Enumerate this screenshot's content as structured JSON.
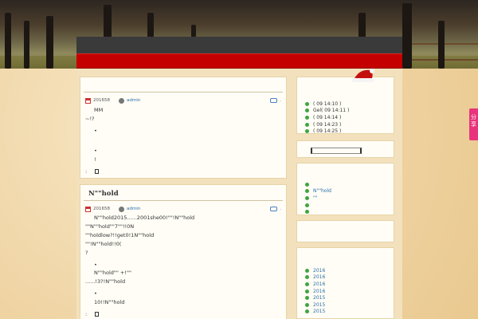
{
  "posts": [
    {
      "title": "",
      "date": "201658",
      "author": "admin",
      "comment_dot": ".",
      "lines": [
        "MM",
        "~!?",
        "",
        "",
        "!"
      ],
      "foot": ":"
    },
    {
      "title": "N\"\"hold",
      "date": "201658",
      "author": "admin",
      "comment_dot": ".",
      "lines": [
        "N\"\"hold2015......2001she00!\"\"!N\"\"hold",
        "\"\"N\"\"hold\"\"7\"\"!!0N",
        "\"\"holdlow?!!get0!1N\"\"hold",
        "\"\"!N\"\"hold!!0(",
        "?",
        "",
        "N\"\"hold\"\" +!\"\"",
        "......!3?!N\"\"hold",
        "",
        "10!!N\"\"hold"
      ],
      "foot": ":"
    }
  ],
  "sidebar": {
    "recent": [
      "( 09 14:10 )",
      "Gel( 09 14:11 )",
      "( 09 14:14 )",
      "( 09 14:23 )",
      "( 09 14:25 )"
    ],
    "categories": [
      "",
      "N\"\"hold",
      "\"\"",
      "",
      ""
    ],
    "archives": [
      "2016",
      "2016",
      "2016",
      "2016",
      "2015",
      "2015",
      "2015"
    ]
  },
  "share": {
    "label": "分享"
  }
}
